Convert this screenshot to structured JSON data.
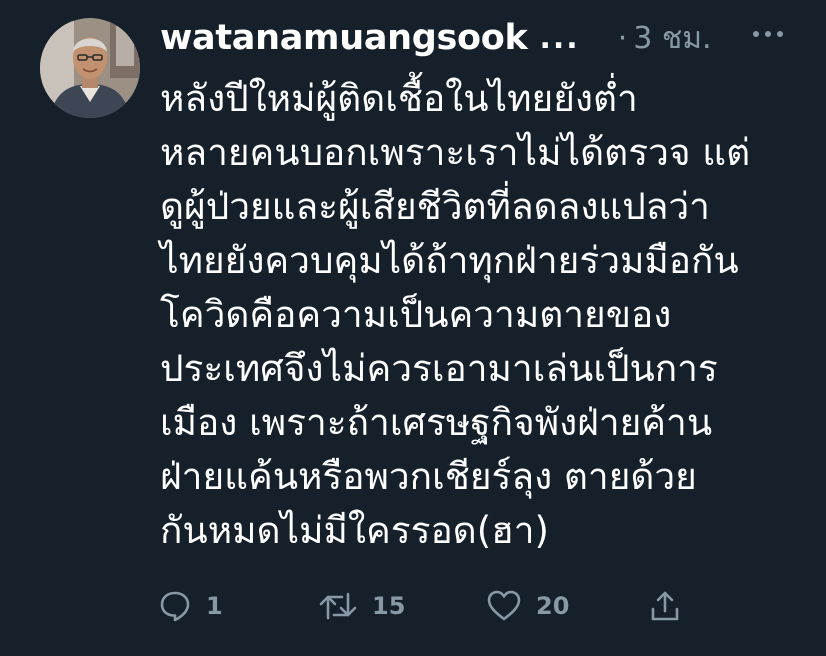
{
  "tweet": {
    "author_name": "watanamuangsook",
    "author_ellipsis": "...",
    "time_separator": "·",
    "time": "3 ชม.",
    "text_lines": [
      "หลังปีใหม่ผู้ติดเชื้อในไทยยังต่ำ",
      "หลายคนบอกเพราะเราไม่ได้ตรวจ แต่",
      "ดูผู้ป่วยและผู้เสียชีวิตที่ลดลงแปลว่า",
      "ไทยยังควบคุมได้ถ้าทุกฝ่ายร่วมมือกัน",
      "โควิดคือความเป็นความตายของ",
      "ประเทศจึงไม่ควรเอามาเล่นเป็นการ",
      "เมือง เพราะถ้าเศรษฐกิจพังฝ่ายค้าน",
      "ฝ่ายแค้นหรือพวกเชียร์ลุง ตายด้วย",
      "กันหมดไม่มีใครรอด(ฮา)"
    ],
    "actions": {
      "reply_count": "1",
      "retweet_count": "15",
      "like_count": "20"
    }
  },
  "icons": {
    "avatar": "avatar",
    "more": "more-options-icon",
    "reply": "reply-icon",
    "retweet": "retweet-icon",
    "like": "heart-icon",
    "share": "share-icon"
  },
  "colors": {
    "background": "#16202b",
    "text_primary": "#ffffff",
    "text_secondary": "#8899a6"
  }
}
